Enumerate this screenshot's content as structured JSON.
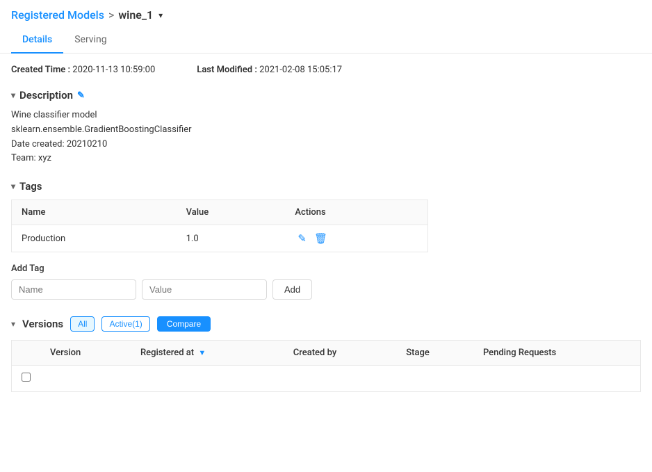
{
  "breadcrumb": {
    "parent_label": "Registered Models",
    "separator": ">",
    "current": "wine_1",
    "dropdown_icon": "▾"
  },
  "tabs": [
    {
      "id": "details",
      "label": "Details",
      "active": true
    },
    {
      "id": "serving",
      "label": "Serving",
      "active": false
    }
  ],
  "meta": {
    "created_label": "Created Time :",
    "created_value": "2020-11-13 10:59:00",
    "modified_label": "Last Modified :",
    "modified_value": "2021-02-08 15:05:17"
  },
  "description": {
    "section_label": "Description",
    "toggle_icon": "▾",
    "edit_icon": "✎",
    "lines": [
      "Wine classifier model",
      "sklearn.ensemble.GradientBoostingClassifier",
      "Date created: 20210210",
      "Team: xyz"
    ]
  },
  "tags": {
    "section_label": "Tags",
    "toggle_icon": "▾",
    "table_headers": [
      "Name",
      "Value",
      "Actions"
    ],
    "rows": [
      {
        "name": "Production",
        "value": "1.0"
      }
    ],
    "add_tag_label": "Add Tag",
    "name_placeholder": "Name",
    "value_placeholder": "Value",
    "add_button_label": "Add"
  },
  "versions": {
    "section_label": "Versions",
    "toggle_icon": "▾",
    "filters": [
      {
        "id": "all",
        "label": "All",
        "active": true
      },
      {
        "id": "active",
        "label": "Active(1)",
        "active": false
      }
    ],
    "compare_button_label": "Compare",
    "table_headers": [
      {
        "id": "checkbox",
        "label": ""
      },
      {
        "id": "version",
        "label": "Version"
      },
      {
        "id": "registered_at",
        "label": "Registered at",
        "sortable": true
      },
      {
        "id": "created_by",
        "label": "Created by"
      },
      {
        "id": "stage",
        "label": "Stage"
      },
      {
        "id": "pending_requests",
        "label": "Pending Requests"
      }
    ]
  },
  "icons": {
    "edit": "✎",
    "delete": "🗑",
    "sort_desc": "▼",
    "chevron_down": "▾",
    "section_collapse": "▾"
  }
}
